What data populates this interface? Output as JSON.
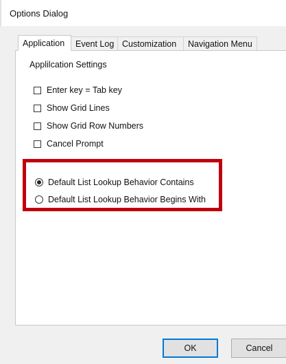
{
  "window": {
    "title": "Options Dialog"
  },
  "tabs": [
    {
      "label": "Application",
      "active": true
    },
    {
      "label": "Event Log",
      "active": false
    },
    {
      "label": "Customization",
      "active": false
    },
    {
      "label": "Navigation Menu",
      "active": false
    }
  ],
  "application": {
    "group_title": "Applilcation Settings",
    "checkboxes": [
      {
        "label": "Enter key = Tab key",
        "checked": false
      },
      {
        "label": "Show Grid Lines",
        "checked": false
      },
      {
        "label": "Show Grid Row Numbers",
        "checked": false
      },
      {
        "label": "Cancel Prompt",
        "checked": false
      }
    ],
    "radios": [
      {
        "label": "Default List Lookup Behavior Contains",
        "selected": true
      },
      {
        "label": "Default List Lookup Behavior Begins With",
        "selected": false
      }
    ],
    "highlight_color": "#c0000c"
  },
  "buttons": {
    "ok_label": "OK",
    "cancel_label": "Cancel"
  }
}
